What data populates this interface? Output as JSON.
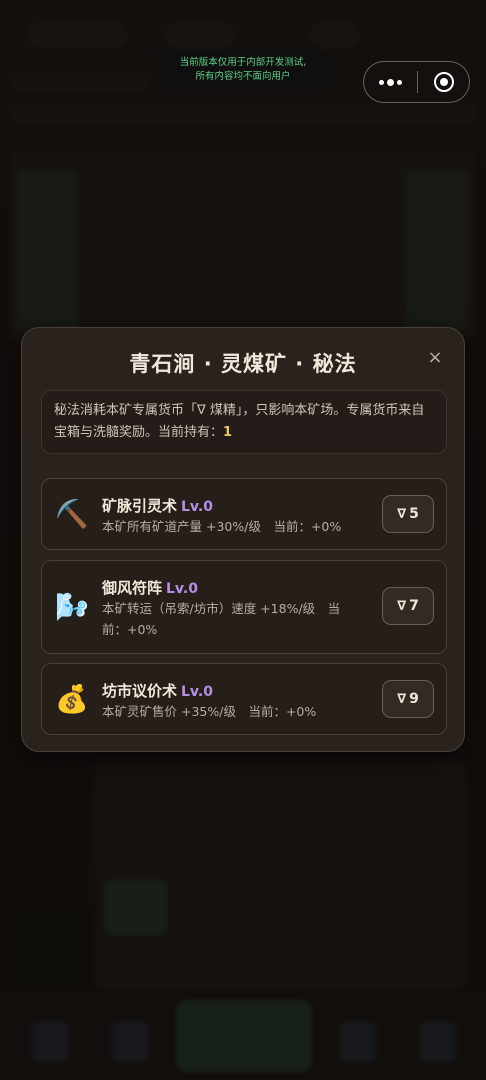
{
  "dev_banner": {
    "line1": "当前版本仅用于内部开发测试,",
    "line2": "所有内容均不面向用户"
  },
  "modal": {
    "title": "青石涧 · 灵煤矿 · 秘法",
    "close_icon": "×",
    "info_text": "秘法消耗本矿专属货币「∇ 煤精」，只影响本矿场。专属货币来自宝箱与洗髓奖励。当前持有：",
    "holding": "1",
    "currency_symbol": "∇",
    "skills": [
      {
        "icon": "pickaxe-icon",
        "glyph": "⛏️",
        "name": "矿脉引灵术",
        "level": "Lv.0",
        "desc": "本矿所有矿道产量 +30%/级　当前：+0%",
        "cost": "5"
      },
      {
        "icon": "wind-icon",
        "glyph": "🌬️",
        "name": "御风符阵",
        "level": "Lv.0",
        "desc": "本矿转运（吊索/坊市）速度 +18%/级　当前：+0%",
        "cost": "7"
      },
      {
        "icon": "money-bag-icon",
        "glyph": "💰",
        "name": "坊市议价术",
        "level": "Lv.0",
        "desc": "本矿灵矿售价 +35%/级　当前：+0%",
        "cost": "9"
      }
    ]
  }
}
